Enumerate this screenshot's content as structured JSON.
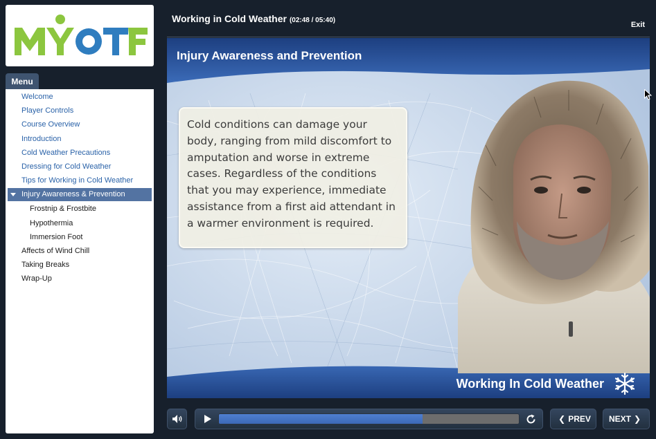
{
  "logo": {
    "text": "MYOTF",
    "colors": {
      "green": "#8cc63f",
      "blue": "#2f7dbf"
    }
  },
  "menu": {
    "tab_label": "Menu",
    "items": [
      {
        "label": "Welcome",
        "state": "link"
      },
      {
        "label": "Player Controls",
        "state": "link"
      },
      {
        "label": "Course Overview",
        "state": "link"
      },
      {
        "label": "Introduction",
        "state": "link"
      },
      {
        "label": "Cold Weather Precautions",
        "state": "link"
      },
      {
        "label": "Dressing for Cold Weather",
        "state": "link"
      },
      {
        "label": "Tips for Working in Cold Weather",
        "state": "link"
      },
      {
        "label": "Injury Awareness & Prevention",
        "state": "active"
      },
      {
        "label": "Frostnip & Frostbite",
        "state": "sub"
      },
      {
        "label": "Hypothermia",
        "state": "sub"
      },
      {
        "label": "Immersion Foot",
        "state": "sub"
      },
      {
        "label": "Affects of Wind Chill",
        "state": "plain"
      },
      {
        "label": "Taking Breaks",
        "state": "plain"
      },
      {
        "label": "Wrap-Up",
        "state": "plain"
      }
    ]
  },
  "header": {
    "course_title": "Working in Cold Weather",
    "time": "(02:48 / 05:40)",
    "exit_label": "Exit"
  },
  "slide": {
    "title": "Injury Awareness and Prevention",
    "body": "Cold conditions can damage your body, ranging from mild discomfort to amputation and worse in extreme cases. Regardless of the conditions that you may experience, immediate assistance from a first aid attendant in a warmer environment is required.",
    "footer_title": "Working In Cold Weather"
  },
  "player": {
    "progress_fraction": 0.68,
    "prev_label": "PREV",
    "next_label": "NEXT",
    "icons": [
      "volume-icon",
      "play-icon",
      "replay-icon",
      "chevron-left-icon",
      "chevron-right-icon"
    ]
  },
  "colors": {
    "background": "#17202c",
    "menu_active": "#5373a2",
    "menu_link": "#2a62a8",
    "progress": "#3c69b8",
    "slide_band": "#2f5ca8"
  }
}
